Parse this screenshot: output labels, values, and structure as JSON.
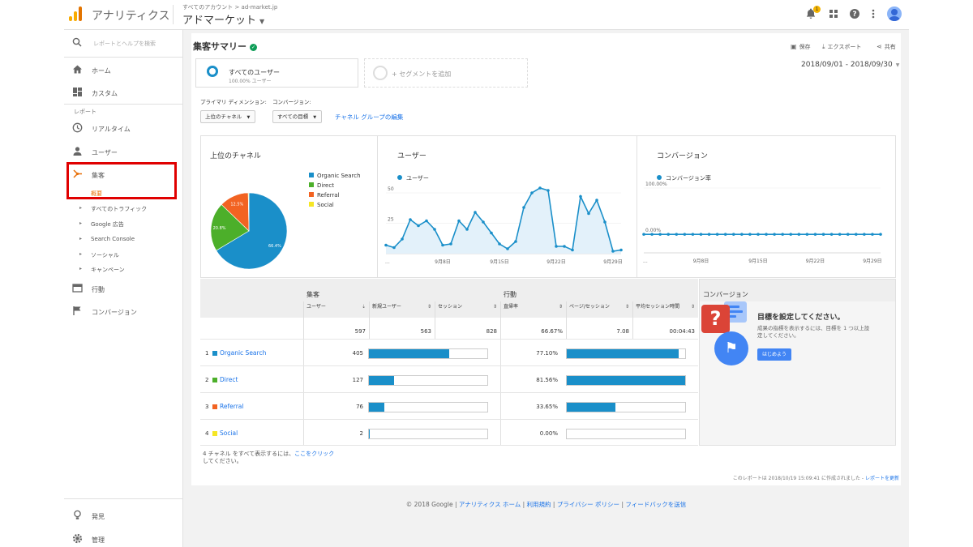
{
  "header": {
    "app_name": "アナリティクス",
    "account_path": "すべてのアカウント > ad-market.jp",
    "property_name": "アドマーケット",
    "notification_count": "1"
  },
  "sidebar": {
    "search_placeholder": "レポートとヘルプを検索",
    "home": "ホーム",
    "custom": "カスタム",
    "reports_label": "レポート",
    "realtime": "リアルタイム",
    "user": "ユーザー",
    "acquisition": "集客",
    "overview": "概要",
    "sub_items": [
      "すべてのトラフィック",
      "Google 広告",
      "Search Console",
      "ソーシャル",
      "キャンペーン"
    ],
    "behavior": "行動",
    "conversion": "コンバージョン",
    "discover": "発見",
    "admin": "管理"
  },
  "report": {
    "title": "集客サマリー",
    "save": "保存",
    "export": "エクスポート",
    "share": "共有",
    "segment_name": "すべてのユーザー",
    "segment_pct": "100.00% ユーザー",
    "add_segment": "+ セグメントを追加",
    "date_range": "2018/09/01 - 2018/09/30",
    "primary_dim_label": "プライマリ ディメンション:",
    "conversion_label": "コンバージョン:",
    "primary_dim_value": "上位のチャネル",
    "conversion_value": "すべての目標",
    "channel_group_link": "チャネル グループの編集"
  },
  "chart_data": [
    {
      "type": "pie",
      "title": "上位のチャネル",
      "labels": [
        "Organic Search",
        "Direct",
        "Referral",
        "Social"
      ],
      "values": [
        66.4,
        20.8,
        12.5,
        0.3
      ],
      "slice_labels": [
        "66.4%",
        "20.8%",
        "12.5%",
        ""
      ],
      "colors": [
        "#1a8fc9",
        "#4caf2a",
        "#f26322",
        "#f5e625"
      ]
    },
    {
      "type": "area",
      "title": "ユーザー",
      "legend": "ユーザー",
      "x_start": "...",
      "x_ticks": [
        "9月8日",
        "9月15日",
        "9月22日",
        "9月29日"
      ],
      "y_ticks": [
        "50",
        "25"
      ],
      "ylim": [
        0,
        62
      ],
      "values": [
        7,
        5,
        12,
        28,
        23,
        27,
        20,
        7,
        8,
        27,
        20,
        34,
        26,
        17,
        8,
        4,
        10,
        38,
        50,
        54,
        52,
        6,
        6,
        3,
        47,
        33,
        44,
        26,
        2,
        3
      ],
      "color": "#1a8fc9"
    },
    {
      "type": "line",
      "title": "コンバージョン",
      "legend": "コンバージョン率",
      "x_start": "...",
      "x_ticks": [
        "9月8日",
        "9月15日",
        "9月22日",
        "9月29日"
      ],
      "y_ticks": [
        "100.00%",
        "0.00%"
      ],
      "ylim": [
        -40,
        100
      ],
      "values": [
        0,
        0,
        0,
        0,
        0,
        0,
        0,
        0,
        0,
        0,
        0,
        0,
        0,
        0,
        0,
        0,
        0,
        0,
        0,
        0,
        0,
        0,
        0,
        0,
        0,
        0,
        0,
        0,
        0,
        0
      ],
      "color": "#1a8fc9"
    }
  ],
  "table": {
    "acq_group": "集客",
    "beh_group": "行動",
    "conv_group": "コンバージョン",
    "col_users": "ユーザー",
    "col_new_users": "新規ユーザー",
    "col_sessions": "セッション",
    "col_bounce": "直帰率",
    "col_pps": "ページ/セッション",
    "col_avg": "平均セッション時間",
    "totals": {
      "users": "597",
      "new_users": "563",
      "sessions": "828",
      "bounce": "66.67%",
      "pps": "7.08",
      "avg": "00:04:43"
    },
    "rows": [
      {
        "num": "1",
        "name": "Organic Search",
        "color": "#1a8fc9",
        "users": "405",
        "users_frac": 0.678,
        "bounce": "77.10%",
        "bounce_frac": 0.945
      },
      {
        "num": "2",
        "name": "Direct",
        "color": "#4caf2a",
        "users": "127",
        "users_frac": 0.213,
        "bounce": "81.56%",
        "bounce_frac": 1.0
      },
      {
        "num": "3",
        "name": "Referral",
        "color": "#f26322",
        "users": "76",
        "users_frac": 0.127,
        "bounce": "33.65%",
        "bounce_frac": 0.413
      },
      {
        "num": "4",
        "name": "Social",
        "color": "#f5e625",
        "users": "2",
        "users_frac": 0.003,
        "bounce": "0.00%",
        "bounce_frac": 0
      }
    ]
  },
  "conversion_panel": {
    "title": "目標を設定してください。",
    "desc": "成果の指標を表示するには、目標を 1 つ以上設定してください。",
    "button": "はじめよう"
  },
  "footnote": {
    "text1": "4 チャネル をすべて表示するには、",
    "link": "ここをクリック",
    "text2": "してください。"
  },
  "created": {
    "text": "このレポートは 2018/10/19 15:09:41 に作成されました - ",
    "link": "レポートを更新"
  },
  "footer": {
    "copyright": "© 2018 Google",
    "links": [
      "アナリティクス ホーム",
      "利用規約",
      "プライバシー ポリシー",
      "フィードバックを送信"
    ]
  }
}
